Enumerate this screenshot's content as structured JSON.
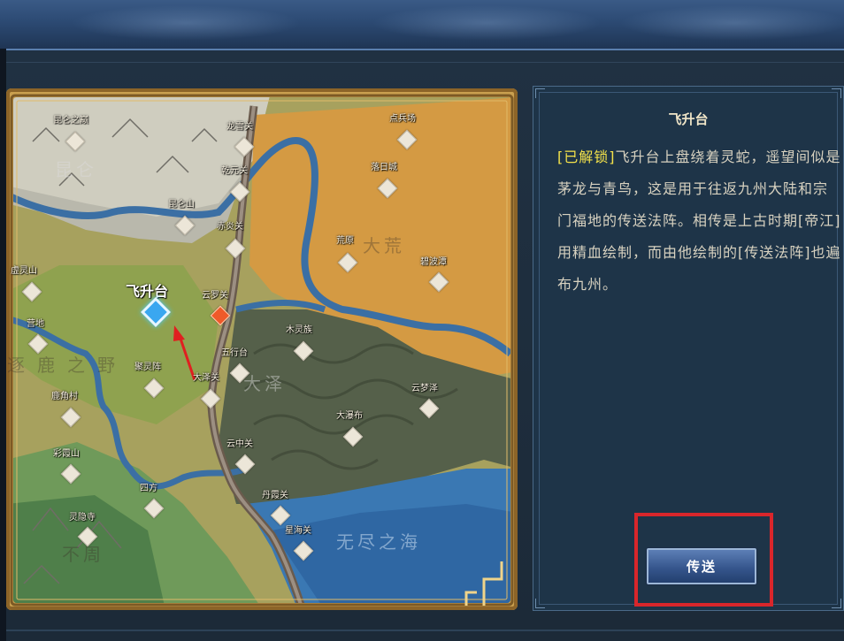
{
  "map": {
    "regions": [
      "昆仑",
      "大荒",
      "逐鹿之野",
      "大泽",
      "无尽之海",
      "不周"
    ],
    "locations": [
      {
        "name": "昆仑之巅",
        "icon": "waypoint-diamond"
      },
      {
        "name": "龙雪关",
        "icon": "waypoint-diamond"
      },
      {
        "name": "点兵场",
        "icon": "waypoint-diamond"
      },
      {
        "name": "乾元关",
        "icon": "waypoint-diamond"
      },
      {
        "name": "落日城",
        "icon": "waypoint-diamond"
      },
      {
        "name": "昆仑山",
        "icon": "waypoint-diamond"
      },
      {
        "name": "赤炎关",
        "icon": "waypoint-diamond"
      },
      {
        "name": "荒原",
        "icon": "waypoint-diamond"
      },
      {
        "name": "碧波潭",
        "icon": "waypoint-diamond"
      },
      {
        "name": "虚灵山",
        "icon": "waypoint-diamond"
      },
      {
        "name": "飞升台",
        "icon": "waypoint-selected"
      },
      {
        "name": "云罗关",
        "icon": "waypoint-current"
      },
      {
        "name": "营地",
        "icon": "waypoint-diamond"
      },
      {
        "name": "木灵族",
        "icon": "waypoint-diamond"
      },
      {
        "name": "五行台",
        "icon": "waypoint-diamond"
      },
      {
        "name": "聚灵阵",
        "icon": "waypoint-diamond"
      },
      {
        "name": "大泽关",
        "icon": "waypoint-diamond"
      },
      {
        "name": "鹿角村",
        "icon": "waypoint-diamond"
      },
      {
        "name": "云梦泽",
        "icon": "waypoint-diamond"
      },
      {
        "name": "大瀑布",
        "icon": "waypoint-diamond"
      },
      {
        "name": "彩霞山",
        "icon": "waypoint-diamond"
      },
      {
        "name": "云中关",
        "icon": "waypoint-diamond"
      },
      {
        "name": "四方",
        "icon": "waypoint-diamond"
      },
      {
        "name": "丹霞关",
        "icon": "waypoint-diamond"
      },
      {
        "name": "灵隐寺",
        "icon": "waypoint-diamond"
      },
      {
        "name": "星海关",
        "icon": "waypoint-diamond"
      }
    ]
  },
  "panel": {
    "title": "飞升台",
    "unlocked_tag": "[已解锁]",
    "description": "飞升台上盘绕着灵蛇，遥望间似是茅龙与青鸟，这是用于往返九州大陆和宗门福地的传送法阵。相传是上古时期[帝江]用精血绘制，而由他绘制的[传送法阵]也遍布九州。",
    "teleport_button": "传送"
  },
  "colors": {
    "tag": "#f4e24a",
    "highlight_box": "#d9262b",
    "selected_marker": "#3aa7f0",
    "current_marker": "#ef5a2a"
  }
}
